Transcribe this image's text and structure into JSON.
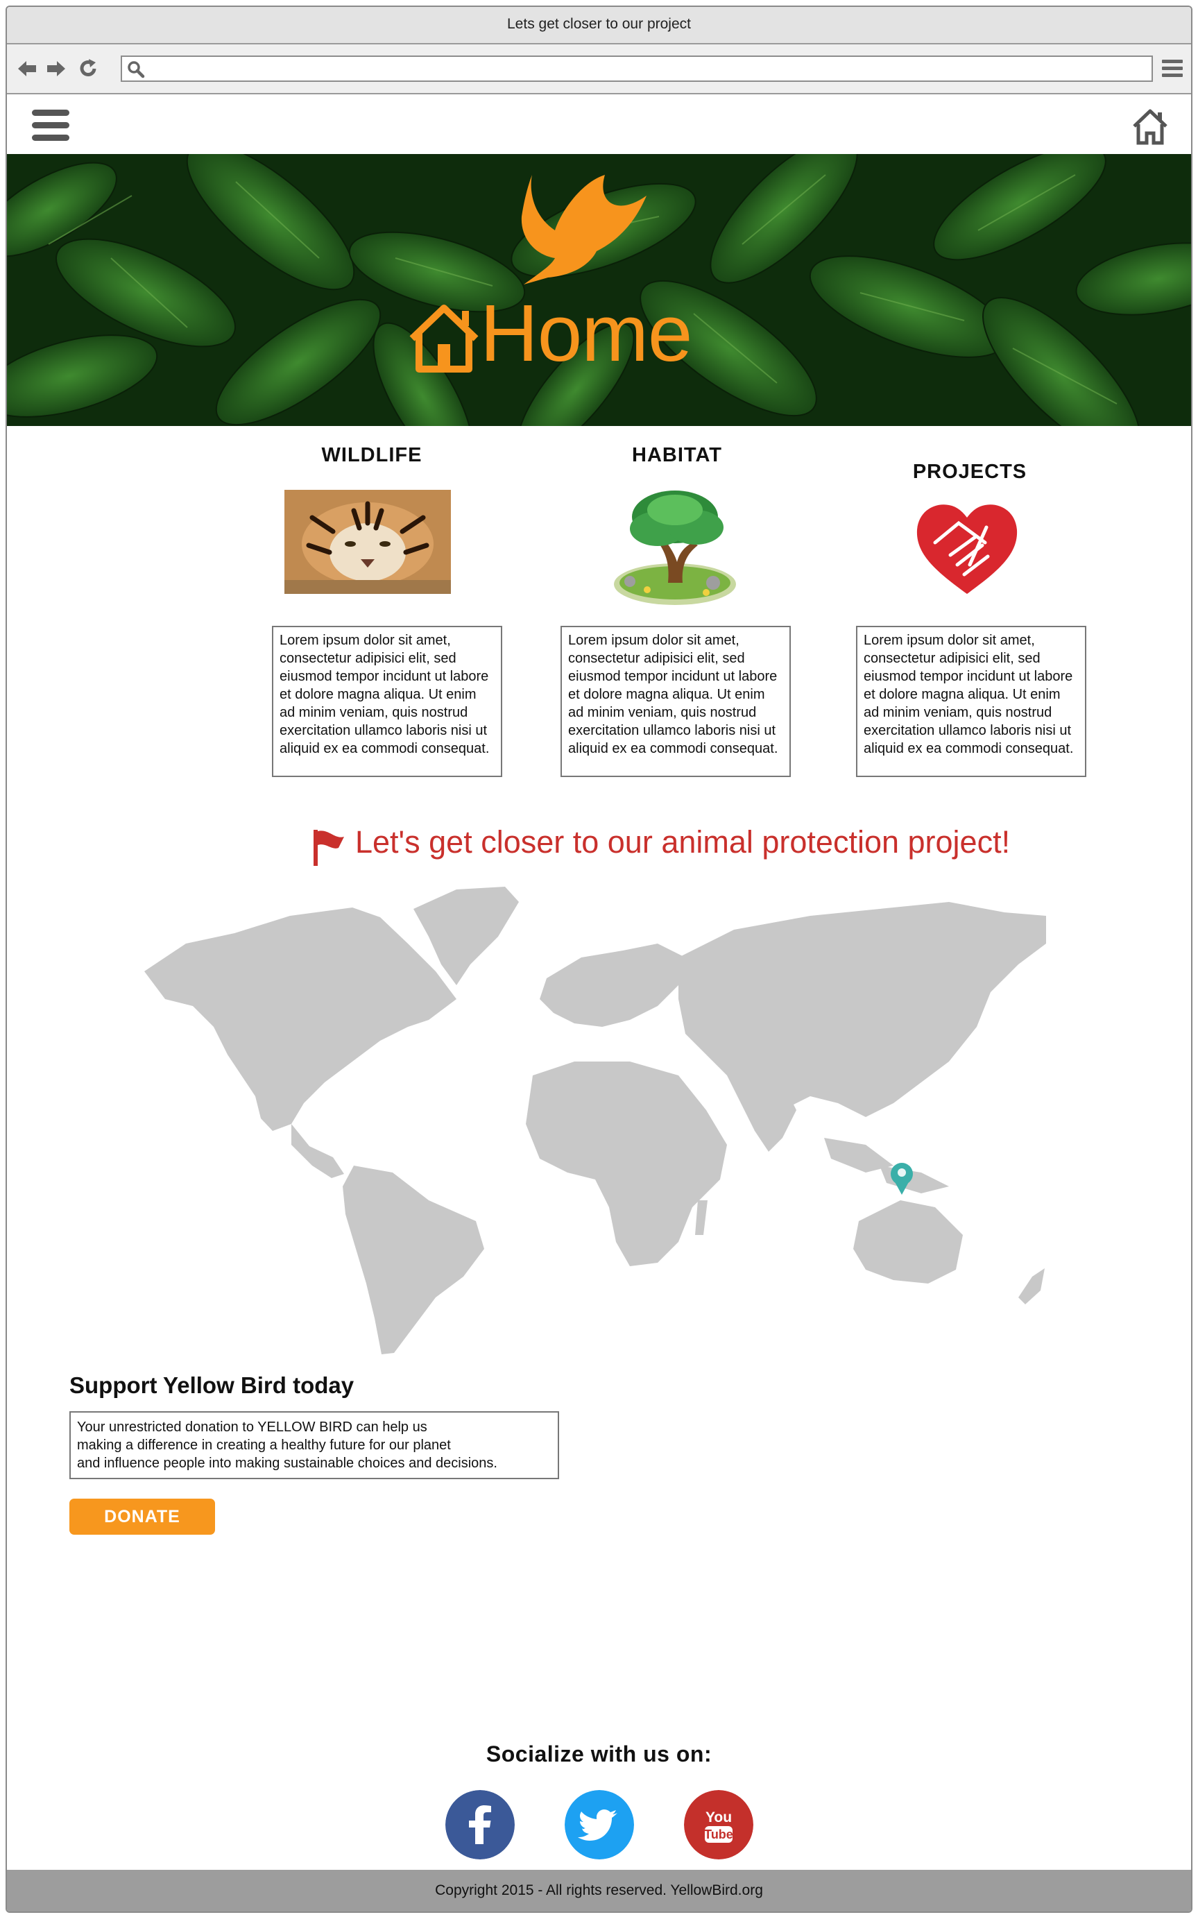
{
  "browser": {
    "window_title": "Lets get closer to our project",
    "url": "",
    "icons": [
      "back-arrow-icon",
      "forward-arrow-icon",
      "reload-icon",
      "search-icon",
      "browser-menu-icon"
    ]
  },
  "header": {
    "menu_icon": "hamburger-icon",
    "home_icon": "home-icon"
  },
  "hero": {
    "title": "Home",
    "logo": "yellow-bird",
    "accent_color": "#f7941d"
  },
  "features": [
    {
      "title": "WILDLIFE",
      "image": "tiger",
      "text": "Lorem ipsum dolor sit amet, consectetur adipisici elit, sed eiusmod tempor incidunt ut labore et dolore magna aliqua. Ut enim ad minim veniam, quis nostrud exercitation ullamco laboris nisi ut aliquid ex ea commodi consequat."
    },
    {
      "title": "HABITAT",
      "image": "tree",
      "text": "Lorem ipsum dolor sit amet, consectetur adipisici elit, sed eiusmod tempor incidunt ut labore et dolore magna aliqua. Ut enim ad minim veniam, quis nostrud exercitation ullamco laboris nisi ut aliquid ex ea commodi consequat."
    },
    {
      "title": "PROJECTS",
      "image": "heart-hands",
      "text": "Lorem ipsum dolor sit amet, consectetur adipisici elit, sed eiusmod tempor incidunt ut labore et dolore magna aliqua. Ut enim ad minim veniam, quis nostrud exercitation ullamco laboris nisi ut aliquid ex ea commodi consequat."
    }
  ],
  "project": {
    "headline": "Let's get closer to our animal protection project!",
    "flag_icon": "flag-icon",
    "headline_color": "#c9302c",
    "map_pin_color": "#3aafa9"
  },
  "support": {
    "title": "Support Yellow Bird today",
    "text_lines": [
      "Your unrestricted donation to YELLOW BIRD can help us",
      "making a difference in creating a healthy future for our planet",
      "and influence people into making sustainable choices and decisions."
    ],
    "donate_label": "DONATE",
    "donate_color": "#f7971e"
  },
  "social": {
    "title": "Socialize with us on:",
    "networks": [
      {
        "name": "facebook",
        "color": "#3b5998"
      },
      {
        "name": "twitter",
        "color": "#1da1f2"
      },
      {
        "name": "youtube",
        "color": "#c4302b"
      }
    ]
  },
  "footer": {
    "text": "Copyright 2015  - All rights reserved. YellowBird.org"
  }
}
